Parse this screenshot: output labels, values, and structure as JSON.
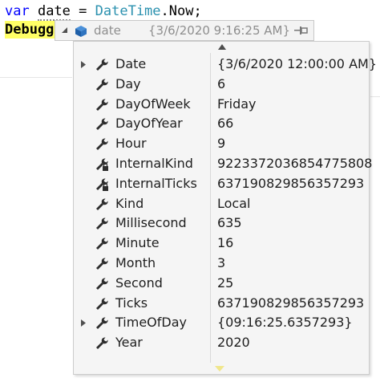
{
  "code": {
    "line1_keyword": "var",
    "line1_var": "date",
    "line1_assign": " = ",
    "line1_type": "DateTime",
    "line1_rest": ".Now;",
    "line2_partial": "Debugg"
  },
  "datatip": {
    "name": "date",
    "value": "{3/6/2020 9:16:25 AM}"
  },
  "properties": [
    {
      "name": "Date",
      "value": "{3/6/2020 12:00:00 AM}",
      "expandable": true,
      "icon": "wrench-icon"
    },
    {
      "name": "Day",
      "value": "6",
      "expandable": false,
      "icon": "wrench-icon"
    },
    {
      "name": "DayOfWeek",
      "value": "Friday",
      "expandable": false,
      "icon": "wrench-icon"
    },
    {
      "name": "DayOfYear",
      "value": "66",
      "expandable": false,
      "icon": "wrench-icon"
    },
    {
      "name": "Hour",
      "value": "9",
      "expandable": false,
      "icon": "wrench-icon"
    },
    {
      "name": "InternalKind",
      "value": "9223372036854775808",
      "expandable": false,
      "icon": "wrench-lock-icon"
    },
    {
      "name": "InternalTicks",
      "value": "637190829856357293",
      "expandable": false,
      "icon": "wrench-lock-icon"
    },
    {
      "name": "Kind",
      "value": "Local",
      "expandable": false,
      "icon": "wrench-icon"
    },
    {
      "name": "Millisecond",
      "value": "635",
      "expandable": false,
      "icon": "wrench-icon"
    },
    {
      "name": "Minute",
      "value": "16",
      "expandable": false,
      "icon": "wrench-icon"
    },
    {
      "name": "Month",
      "value": "3",
      "expandable": false,
      "icon": "wrench-icon"
    },
    {
      "name": "Second",
      "value": "25",
      "expandable": false,
      "icon": "wrench-icon"
    },
    {
      "name": "Ticks",
      "value": "637190829856357293",
      "expandable": false,
      "icon": "wrench-icon"
    },
    {
      "name": "TimeOfDay",
      "value": "{09:16:25.6357293}",
      "expandable": true,
      "icon": "wrench-icon"
    },
    {
      "name": "Year",
      "value": "2020",
      "expandable": false,
      "icon": "wrench-icon"
    }
  ],
  "colors": {
    "keyword": "#0000ff",
    "type": "#2b91af",
    "highlight": "#ffff66",
    "scroll_arrow_down": "#f0e68c"
  }
}
